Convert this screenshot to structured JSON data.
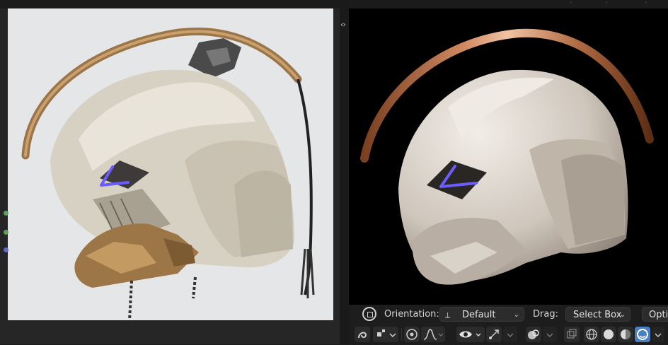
{
  "header": {
    "orientation_label": "Orientation:",
    "orientation_value": "Default",
    "drag_label": "Drag:",
    "drag_value": "Select Box",
    "options_label": "Opti"
  },
  "toolbar": {
    "icons": [
      "transform-pivot-icon",
      "snap-icon",
      "snap-target-icon",
      "proportional-edit-icon",
      "falloff-icon",
      "visibility-icon",
      "gizmo-icon",
      "overlay-icon",
      "xray-icon",
      "wireframe-shading-icon",
      "solid-shading-icon",
      "material-shading-icon",
      "rendered-shading-icon"
    ]
  },
  "colors": {
    "accent": "#4a7fc1",
    "background": "#1d1d1d",
    "viewport": "#000000",
    "visor_glow": "#5b4dff"
  }
}
